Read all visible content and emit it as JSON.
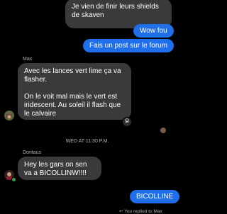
{
  "messages": {
    "m1": {
      "text": "Je vien de finir leurs shields de skaven"
    },
    "m2": {
      "text": "Wow fou"
    },
    "m3": {
      "text": "Fais un post sur le forum"
    },
    "m4": {
      "sender": "Max",
      "para1": "Avec les lances vert lime ça va flasher.",
      "para2": "On le voit mal mais le vert est iridescent. Au soleil il flash que le calvaire",
      "reaction": "😮"
    },
    "divider": {
      "text": "WED AT 11:30 P.M."
    },
    "m5": {
      "sender": "Doritaus",
      "text": "Hey les gars on sen va a BICOLLINW!!!!"
    },
    "m6": {
      "text": "BICOLLINE"
    },
    "footer": {
      "text": "↩ You replied to Max"
    }
  }
}
